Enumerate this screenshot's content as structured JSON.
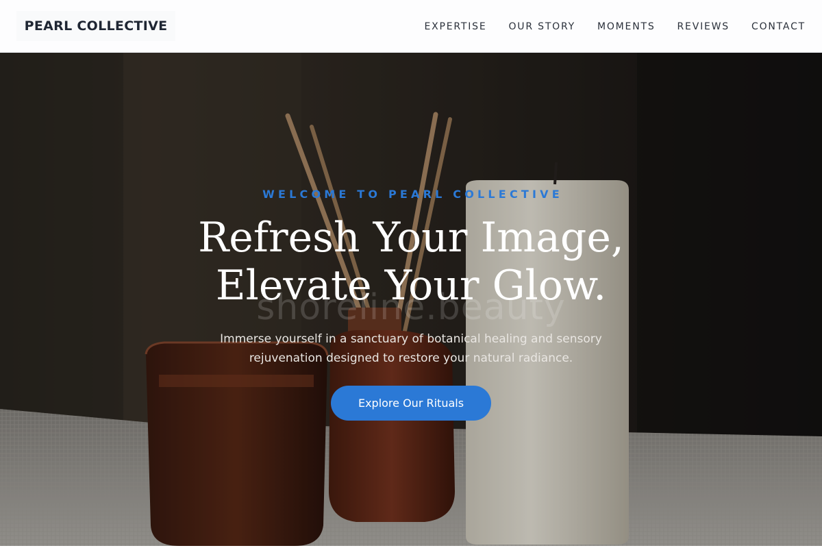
{
  "brand": {
    "name": "PEARL COLLECTIVE"
  },
  "nav": {
    "items": [
      {
        "label": "EXPERTISE"
      },
      {
        "label": "OUR STORY"
      },
      {
        "label": "MOMENTS"
      },
      {
        "label": "REVIEWS"
      },
      {
        "label": "CONTACT"
      }
    ]
  },
  "hero": {
    "eyebrow": "WELCOME TO PEARL COLLECTIVE",
    "headline_line1": "Refresh Your Image,",
    "headline_line2": "Elevate Your Glow.",
    "watermark": "shoreline.beauty",
    "subtext_line1": "Immerse yourself in a sanctuary of botanical healing and sensory",
    "subtext_line2": "rejuvenation designed to restore your natural radiance.",
    "cta_label": "Explore Our Rituals",
    "background_image": "candle-diffuser-spa-photo"
  },
  "colors": {
    "accent": "#2b79d6",
    "heading_text": "#1f2633",
    "hero_text": "#ffffff"
  }
}
